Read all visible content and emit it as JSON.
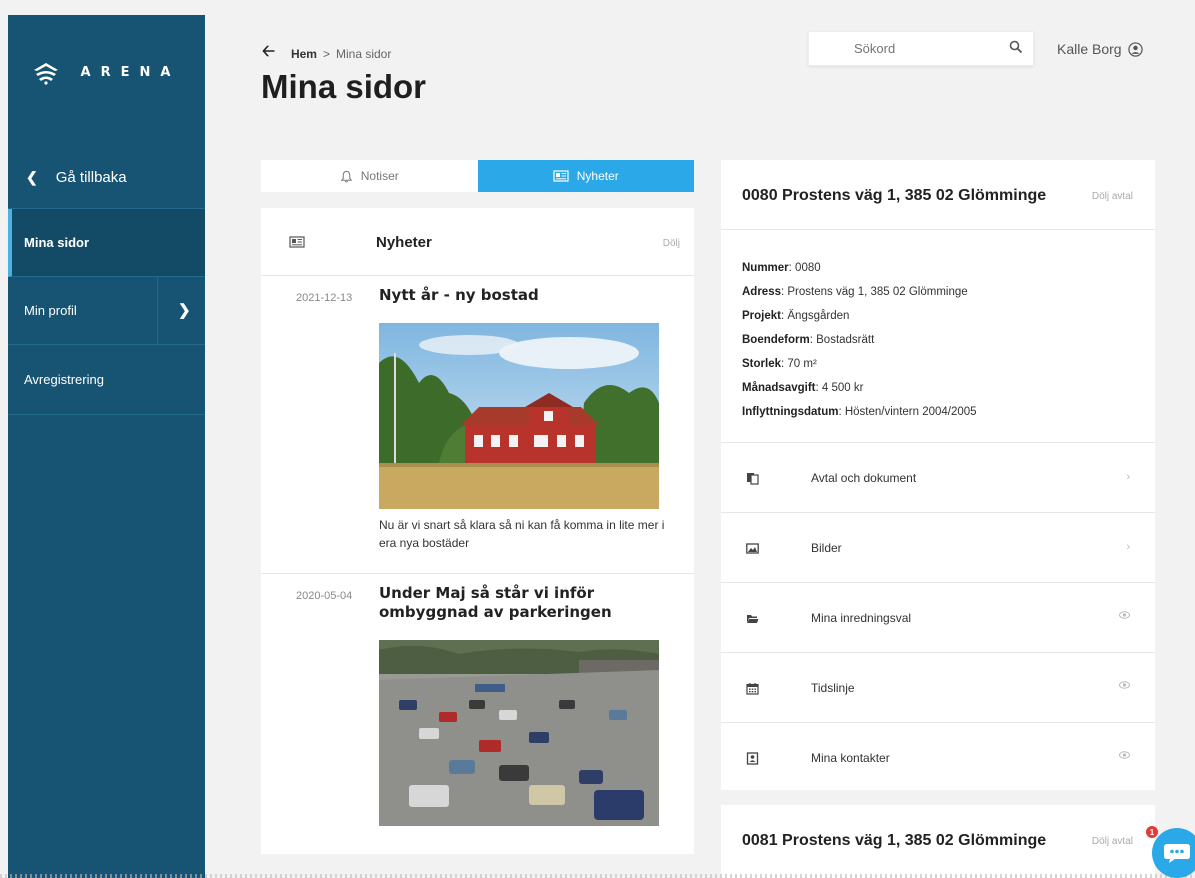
{
  "brand": {
    "name": "ARENA"
  },
  "sidebar": {
    "back_label": "Gå tillbaka",
    "items": [
      {
        "label": "Mina sidor"
      },
      {
        "label": "Min profil"
      },
      {
        "label": "Avregistrering"
      }
    ]
  },
  "header": {
    "breadcrumb_home": "Hem",
    "breadcrumb_sep": ">",
    "breadcrumb_current": "Mina sidor",
    "title": "Mina sidor",
    "search_placeholder": "Sökord",
    "user_name": "Kalle Borg"
  },
  "tabs": [
    {
      "label": "Notiser",
      "active": false
    },
    {
      "label": "Nyheter",
      "active": true
    }
  ],
  "news": {
    "title": "Nyheter",
    "hide_label": "Dölj",
    "articles": [
      {
        "date": "2021-12-13",
        "headline": "Nytt år - ny bostad",
        "body": "Nu är vi snart så klara så ni kan få komma in lite mer i era nya bostäder"
      },
      {
        "date": "2020-05-04",
        "headline": "Under Maj så står vi inför ombyggnad av parkeringen",
        "body": ""
      }
    ]
  },
  "properties": [
    {
      "title": "0080 Prostens väg 1, 385 02 Glömminge",
      "hide_label": "Dölj avtal",
      "details": [
        {
          "key": "Nummer",
          "value": "0080"
        },
        {
          "key": "Adress",
          "value": "Prostens väg 1, 385 02 Glömminge"
        },
        {
          "key": "Projekt",
          "value": "Ängsgården"
        },
        {
          "key": "Boendeform",
          "value": "Bostadsrätt"
        },
        {
          "key": "Storlek",
          "value": "70 m²"
        },
        {
          "key": "Månadsavgift",
          "value": "4 500 kr"
        },
        {
          "key": "Inflyttningsdatum",
          "value": "Hösten/vintern 2004/2005"
        }
      ],
      "menu": [
        {
          "label": "Avtal och dokument",
          "icon": "documents-icon",
          "right": "chevron"
        },
        {
          "label": "Bilder",
          "icon": "image-icon",
          "right": "chevron"
        },
        {
          "label": "Mina inredningsval",
          "icon": "folder-icon",
          "right": "eye"
        },
        {
          "label": "Tidslinje",
          "icon": "calendar-icon",
          "right": "eye"
        },
        {
          "label": "Mina kontakter",
          "icon": "contact-icon",
          "right": "eye"
        }
      ]
    },
    {
      "title": "0081 Prostens väg 1, 385 02 Glömminge",
      "hide_label": "Dölj avtal"
    }
  ],
  "chat": {
    "badge": "1"
  },
  "colors": {
    "sidebar": "#175473",
    "accent": "#2ba8e8",
    "badge": "#e53935"
  }
}
